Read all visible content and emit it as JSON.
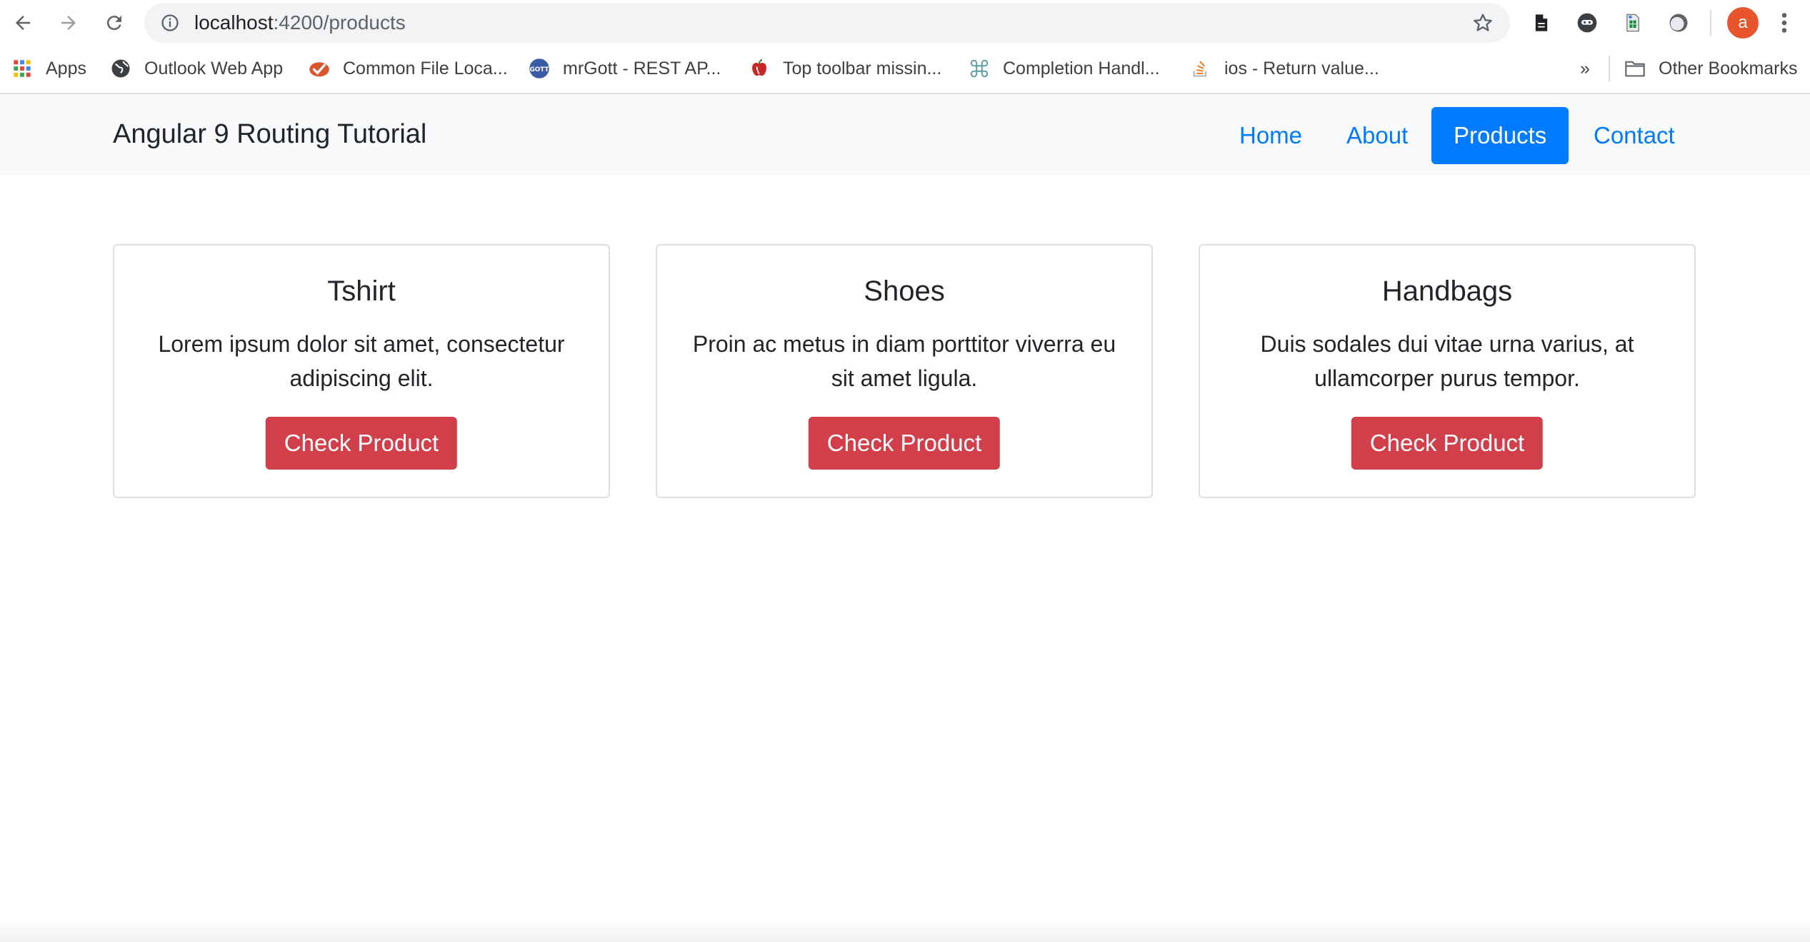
{
  "browser": {
    "url_host": "localhost",
    "url_rest": ":4200/products",
    "avatar_letter": "a"
  },
  "bookmarks": {
    "items": [
      {
        "label": "Apps",
        "icon": "apps-grid-icon"
      },
      {
        "label": "Outlook Web App",
        "icon": "globe-icon"
      },
      {
        "label": "Common File Loca...",
        "icon": "checkmark-badge-icon"
      },
      {
        "label": "mrGott - REST AP...",
        "icon": "gott-icon"
      },
      {
        "label": "Top toolbar missin...",
        "icon": "apple-icon"
      },
      {
        "label": "Completion Handl...",
        "icon": "command-icon"
      },
      {
        "label": "ios - Return value...",
        "icon": "stackoverflow-icon"
      }
    ],
    "overflow": "»",
    "other_label": "Other Bookmarks"
  },
  "app": {
    "brand": "Angular 9 Routing Tutorial",
    "nav": [
      {
        "label": "Home",
        "active": false
      },
      {
        "label": "About",
        "active": false
      },
      {
        "label": "Products",
        "active": true
      },
      {
        "label": "Contact",
        "active": false
      }
    ]
  },
  "products": [
    {
      "title": "Tshirt",
      "text": "Lorem ipsum dolor sit amet, consectetur adipiscing elit.",
      "button": "Check Product"
    },
    {
      "title": "Shoes",
      "text": "Proin ac metus in diam porttitor viverra eu sit amet ligula.",
      "button": "Check Product"
    },
    {
      "title": "Handbags",
      "text": "Duis sodales dui vitae urna varius, at ullamcorper purus tempor.",
      "button": "Check Product"
    }
  ],
  "colors": {
    "primary": "#007bff",
    "danger": "#d1404a",
    "navbar_bg": "#f8f9fa",
    "avatar": "#e8552c"
  }
}
